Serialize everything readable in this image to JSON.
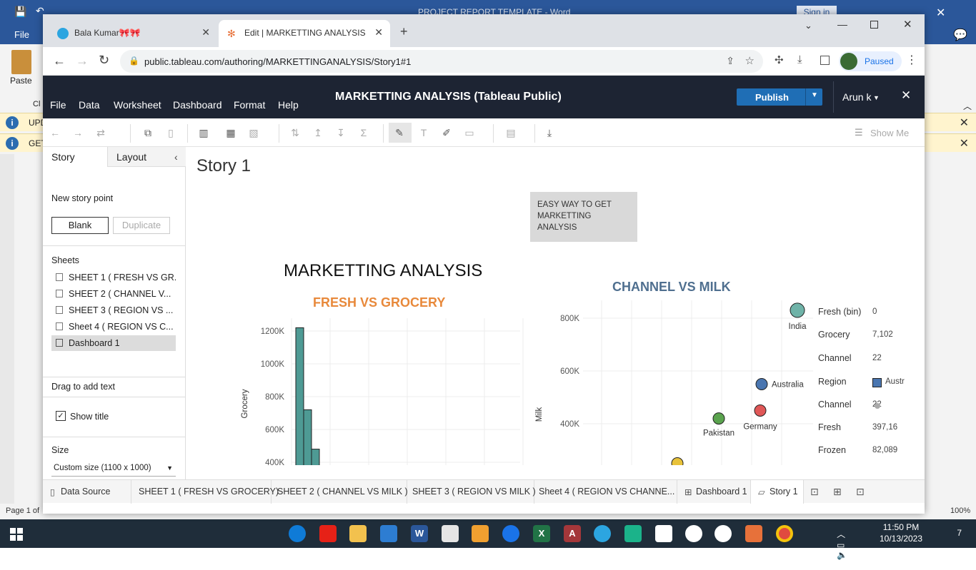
{
  "word": {
    "title": "PROJECT REPORT TEMPLATE - Word",
    "sign_in": "Sign in",
    "file_tab": "File",
    "paste_label": "Paste",
    "clip_label": "Cl",
    "bar1_text": "UPD",
    "bar2_text": "GET",
    "page_status": "Page 1 of",
    "zoom": "100%"
  },
  "chrome": {
    "tabs": [
      {
        "label": "Bala Kumar🎀🎀",
        "active": false
      },
      {
        "label": "Edit | MARKETTING ANALYSIS",
        "active": true
      }
    ],
    "url": "public.tableau.com/authoring/MARKETTINGANALYSIS/Story1#1",
    "profile_status": "Paused"
  },
  "tableau": {
    "menu": [
      "File",
      "Data",
      "Worksheet",
      "Dashboard",
      "Format",
      "Help"
    ],
    "title": "MARKETTING ANALYSIS (Tableau Public)",
    "publish": "Publish",
    "user": "Arun k",
    "show_me": "Show Me",
    "side": {
      "tab_story": "Story",
      "tab_layout": "Layout",
      "new_story_point": "New story point",
      "blank": "Blank",
      "duplicate": "Duplicate",
      "sheets_header": "Sheets",
      "sheets": [
        "SHEET 1 ( FRESH VS GR...",
        "SHEET 2 ( CHANNEL V...",
        "SHEET 3 ( REGION VS ...",
        "Sheet 4 ( REGION VS C...",
        "Dashboard 1"
      ],
      "drag_text": "Drag to add text",
      "show_title": "Show title",
      "size_header": "Size",
      "size_value": "Custom size (1100 x 1000)"
    },
    "story_title": "Story 1",
    "caption": "EASY WAY TO GET MARKETTING ANALYSIS",
    "dashboard_title": "MARKETTING ANALYSIS",
    "bottom_tabs": [
      "Data Source",
      "SHEET 1 ( FRESH VS GROCERY)",
      "SHEET 2 ( CHANNEL VS MILK )",
      "SHEET 3 ( REGION VS MILK )",
      "Sheet 4 ( REGION VS CHANNE...",
      "Dashboard 1",
      "Story 1"
    ],
    "tooltip": {
      "rows": [
        {
          "label": "Fresh (bin)",
          "value": "0"
        },
        {
          "label": "Grocery",
          "value": "7,102"
        },
        {
          "label": "Channel",
          "value": "22"
        },
        {
          "label": "Region",
          "value": "Austr"
        },
        {
          "label": "Channel",
          "value": "22"
        },
        {
          "label": "Fresh",
          "value": "397,16"
        },
        {
          "label": "Frozen",
          "value": "82,089"
        }
      ]
    }
  },
  "taskbar": {
    "time": "11:50 PM",
    "date": "10/13/2023",
    "notif_count": "7"
  },
  "chart_data": [
    {
      "type": "bar",
      "title": "FRESH VS GROCERY",
      "ylabel": "Grocery",
      "xlabel": "",
      "yticks": [
        "1200K",
        "1000K",
        "800K",
        "600K",
        "400K"
      ],
      "ylim": [
        400000,
        1200000
      ],
      "values": [
        1220000,
        720000,
        480000
      ],
      "color": "#4e9a94"
    },
    {
      "type": "scatter",
      "title": "CHANNEL VS MILK",
      "ylabel": "Milk",
      "yticks": [
        "800K",
        "600K",
        "400K"
      ],
      "ylim": [
        400000,
        800000
      ],
      "points": [
        {
          "label": "India",
          "y": 830000,
          "color": "#6fb3a8"
        },
        {
          "label": "Australia",
          "y": 550000,
          "color": "#4a76b0"
        },
        {
          "label": "Germany",
          "y": 450000,
          "color": "#e05757"
        },
        {
          "label": "Pakistan",
          "y": 420000,
          "color": "#5aa34e"
        },
        {
          "label": "",
          "y": 250000,
          "color": "#e8c23a"
        }
      ]
    }
  ]
}
